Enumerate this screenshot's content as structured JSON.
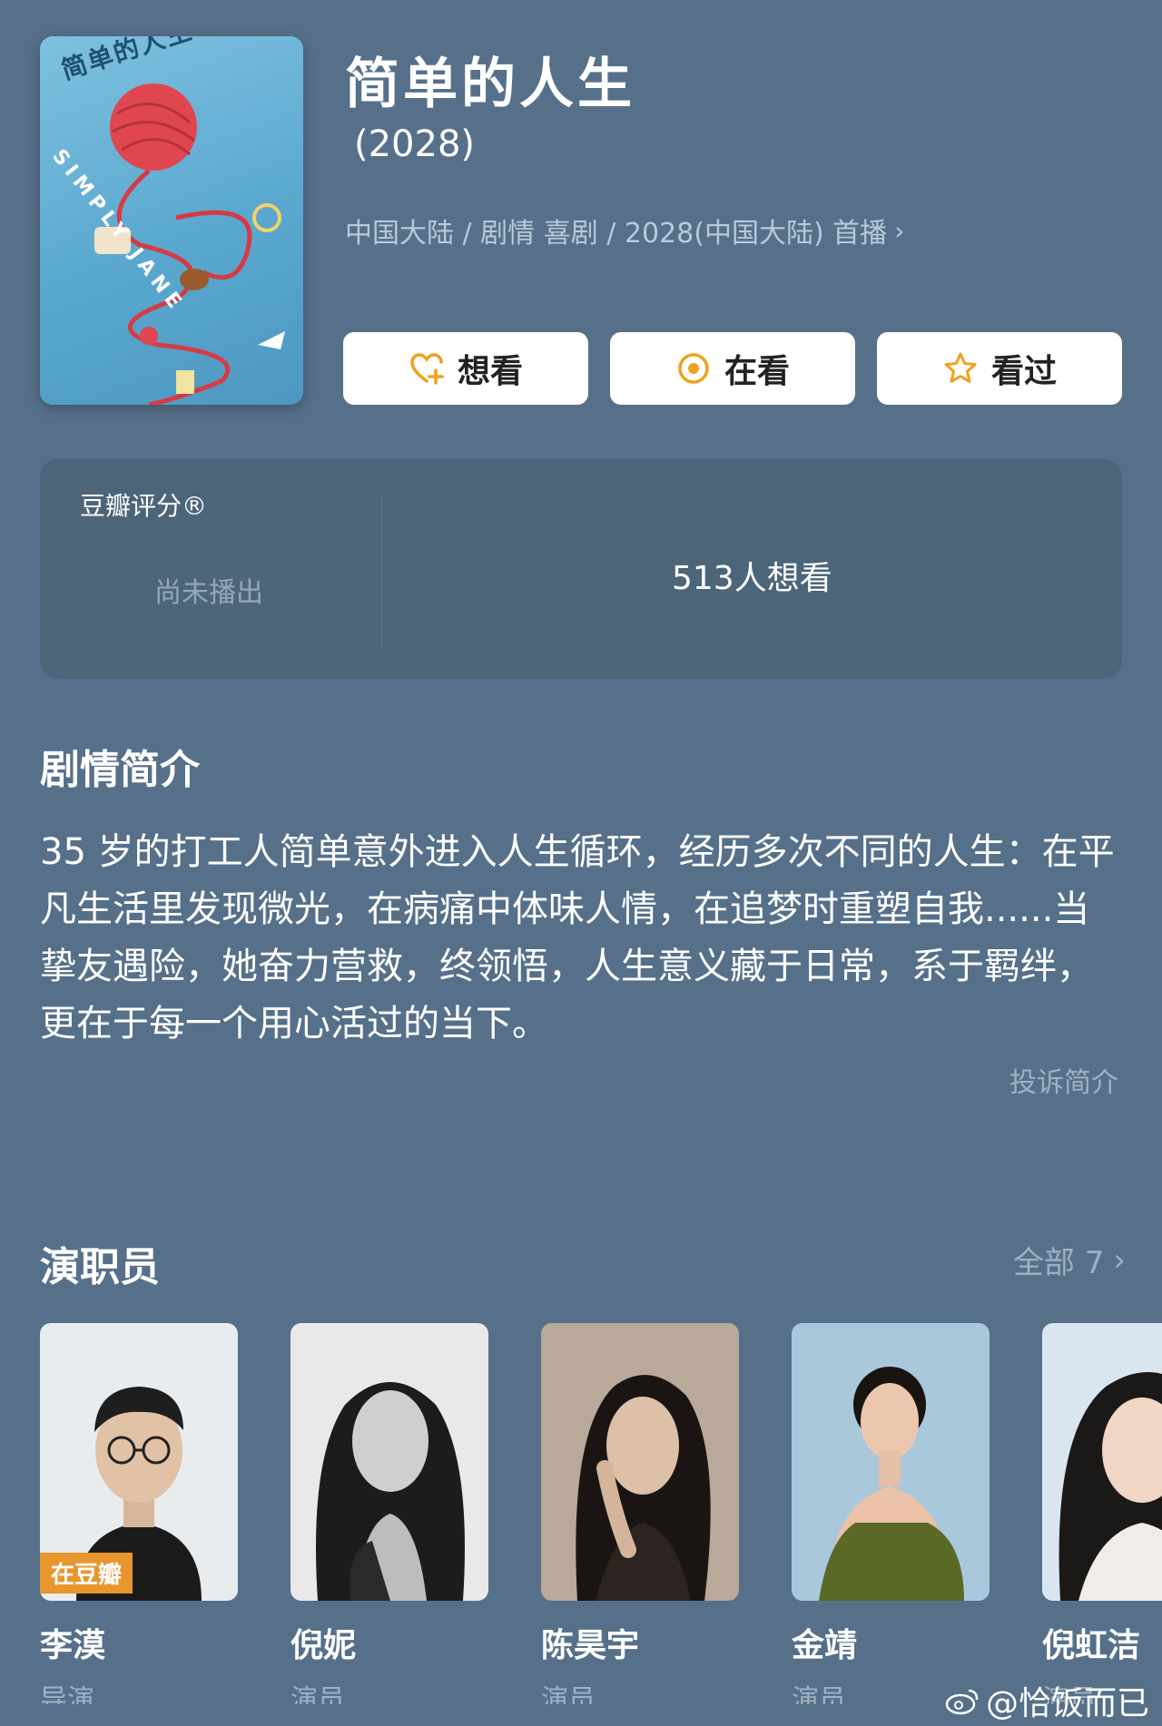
{
  "show": {
    "title": "简单的人生",
    "year": "(2028)",
    "meta": "中国大陆 / 剧情 喜剧 / 2028(中国大陆) 首播",
    "poster": {
      "title": "简单的人生",
      "subtitle": "SIMPLY JANE"
    }
  },
  "actions": [
    {
      "label": "想看",
      "icon": "heart-plus-icon"
    },
    {
      "label": "在看",
      "icon": "target-circle-icon"
    },
    {
      "label": "看过",
      "icon": "star-icon"
    }
  ],
  "rating": {
    "label": "豆瓣评分®",
    "status": "尚未播出",
    "want_count": "513人想看"
  },
  "synopsis": {
    "heading": "剧情简介",
    "text": "35 岁的打工人简单意外进入人生循环，经历多次不同的人生：在平凡生活里发现微光，在病痛中体味人情，在追梦时重塑自我......当挚友遇险，她奋力营救，终领悟，人生意义藏于日常，系于羁绊，更在于每一个用心活过的当下。",
    "report": "投诉简介"
  },
  "cast": {
    "heading": "演职员",
    "all_label": "全部 7",
    "members": [
      {
        "name": "李漠",
        "role": "导演",
        "badge": "在豆瓣"
      },
      {
        "name": "倪妮",
        "role": "演员"
      },
      {
        "name": "陈昊宇",
        "role": "演员"
      },
      {
        "name": "金靖",
        "role": "演员"
      },
      {
        "name": "倪虹洁",
        "role": "演员"
      }
    ]
  },
  "watermark": "@恰饭而已",
  "colors": {
    "background": "#56708a",
    "card": "#4d6579",
    "accent": "#f0a020",
    "badge": "#e8962e"
  }
}
